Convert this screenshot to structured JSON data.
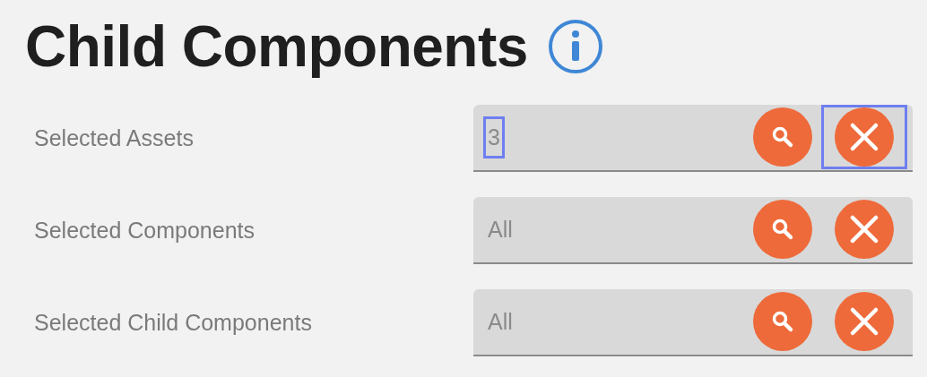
{
  "title": "Child Components",
  "rows": [
    {
      "label": "Selected Assets",
      "value": "3",
      "value_highlighted": true,
      "clear_highlighted": true
    },
    {
      "label": "Selected Components",
      "value": "All",
      "value_highlighted": false,
      "clear_highlighted": false
    },
    {
      "label": "Selected Child Components",
      "value": "All",
      "value_highlighted": false,
      "clear_highlighted": false
    }
  ]
}
